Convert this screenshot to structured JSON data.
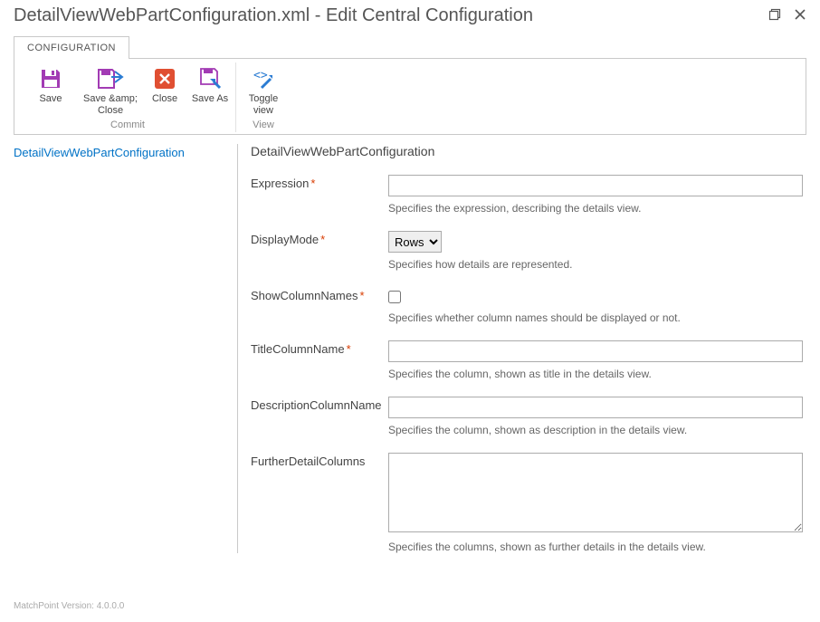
{
  "window": {
    "title": "DetailViewWebPartConfiguration.xml - Edit Central Configuration"
  },
  "tabs": {
    "configuration": "CONFIGURATION"
  },
  "ribbon": {
    "commit_group": "Commit",
    "view_group": "View",
    "save": "Save",
    "save_close": "Save &amp; Close",
    "close": "Close",
    "save_as": "Save As",
    "toggle_view": "Toggle view"
  },
  "nav": {
    "item": "DetailViewWebPartConfiguration"
  },
  "form": {
    "heading": "DetailViewWebPartConfiguration",
    "expression": {
      "label": "Expression",
      "value": "",
      "hint": "Specifies the expression, describing the details view."
    },
    "displayMode": {
      "label": "DisplayMode",
      "value": "Rows",
      "hint": "Specifies how details are represented."
    },
    "showColumnNames": {
      "label": "ShowColumnNames",
      "checked": false,
      "hint": "Specifies whether column names should be displayed or not."
    },
    "titleColumnName": {
      "label": "TitleColumnName",
      "value": "",
      "hint": "Specifies the column, shown as title in the details view."
    },
    "descriptionColumnName": {
      "label": "DescriptionColumnName",
      "value": "",
      "hint": "Specifies the column, shown as description in the details view."
    },
    "furtherDetailColumns": {
      "label": "FurtherDetailColumns",
      "value": "",
      "hint": "Specifies the columns, shown as further details in the details view."
    }
  },
  "footer": {
    "version": "MatchPoint Version: 4.0.0.0"
  }
}
